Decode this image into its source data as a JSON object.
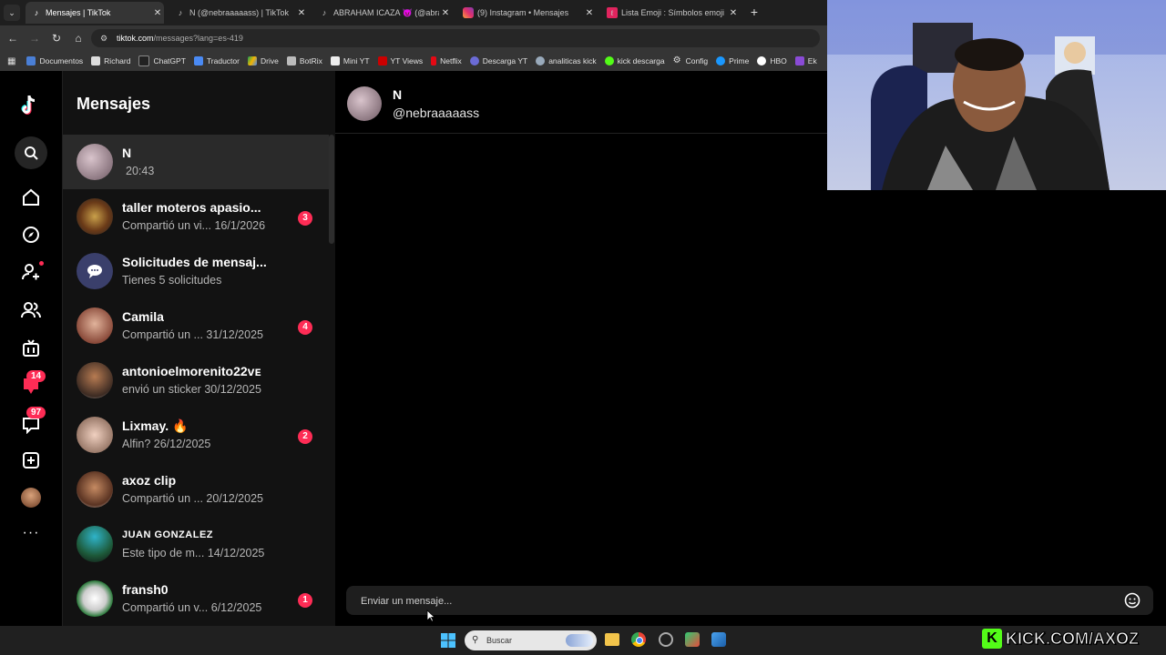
{
  "browser": {
    "tabs": [
      {
        "title": "Mensajes | TikTok",
        "icon": "tiktok-icon",
        "active": true
      },
      {
        "title": "N (@nebraaaaass) | TikTok",
        "icon": "tiktok-icon",
        "active": false
      },
      {
        "title": "ABRAHAM ICAZA 😈 (@abrah",
        "icon": "tiktok-icon",
        "active": false
      },
      {
        "title": "(9) Instagram • Mensajes",
        "icon": "instagram-icon",
        "active": false
      },
      {
        "title": "Lista Emoji : Símbolos emoji na",
        "icon": "emoji-site-icon",
        "active": false
      }
    ],
    "url_host": "tiktok.com",
    "url_path": "/messages?lang=es-419",
    "bookmarks": [
      "Documentos",
      "Richard",
      "ChatGPT",
      "Traductor",
      "Drive",
      "BotRix",
      "Mini YT",
      "YT Views",
      "Netflix",
      "Descarga YT",
      "analiticas kick",
      "kick descarga",
      "Config",
      "Prime",
      "HBO",
      "Ek"
    ]
  },
  "rail": {
    "badge_activity": "14",
    "badge_messages": "97"
  },
  "inbox": {
    "title": "Mensajes",
    "conversations": [
      {
        "name": "N",
        "time": "20:43",
        "preview": "",
        "badge": ""
      },
      {
        "name": "taller moteros apasio...",
        "preview": "Compartió un vi...",
        "date": "16/1/2026",
        "badge": "3"
      },
      {
        "name": "Solicitudes de mensaj...",
        "preview": "Tienes 5 solicitudes",
        "date": "",
        "badge": ""
      },
      {
        "name": "Camila",
        "preview": "Compartió un ...",
        "date": "31/12/2025",
        "badge": "4"
      },
      {
        "name": "antonioelmorenito22ᴠᴇ",
        "preview": "envió un sticker",
        "date": "30/12/2025",
        "badge": ""
      },
      {
        "name": "Lixmay. 🔥",
        "preview": "Alfin?",
        "date": "26/12/2025",
        "badge": "2"
      },
      {
        "name": "axoz clip",
        "preview": "Compartió un ...",
        "date": "20/12/2025",
        "badge": ""
      },
      {
        "name": "JUAN GONZALEZ",
        "preview": "Este tipo de m...",
        "date": "14/12/2025",
        "badge": ""
      },
      {
        "name": "fransh0",
        "preview": "Compartió un v...",
        "date": "6/12/2025",
        "badge": "1"
      }
    ]
  },
  "chat": {
    "name": "N",
    "handle": "@nebraaaaass",
    "placeholder": "Enviar un mensaje..."
  },
  "taskbar": {
    "search_label": "Buscar"
  },
  "overlay": {
    "kick_text": "KICK.COM/AXOZ"
  },
  "colors": {
    "accent": "#fe2c55",
    "panel": "#121212",
    "selected": "#2a2a2a"
  }
}
